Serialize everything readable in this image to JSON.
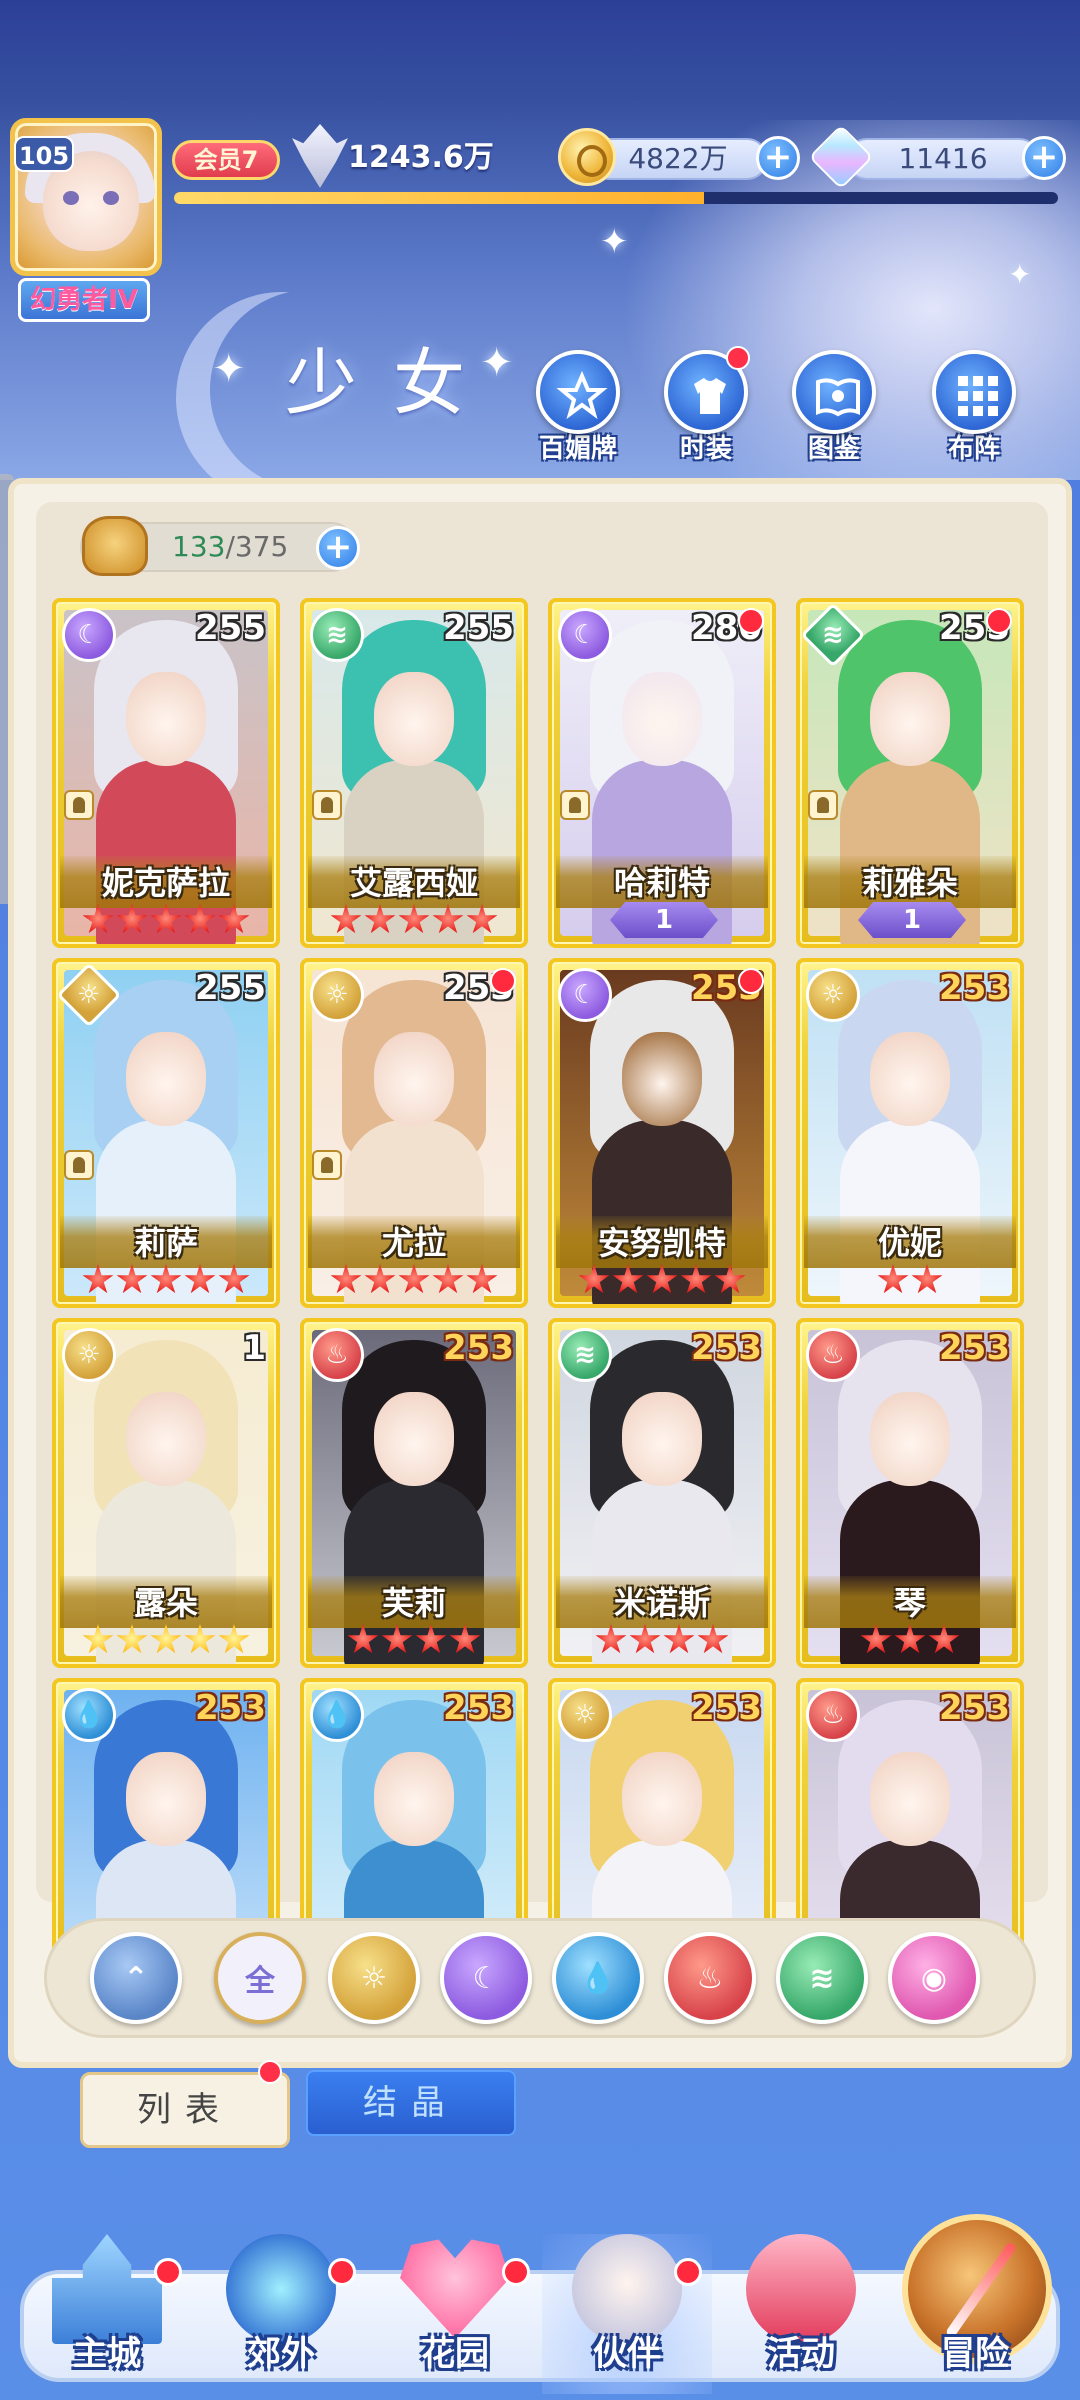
{
  "player": {
    "level": "105",
    "title": "幻勇者IV",
    "vip": "会员7",
    "power": "1243.6万",
    "gold": "4822万",
    "gems": "11416",
    "exp_progress": 0.6
  },
  "section_title": "少女",
  "top_menu": [
    {
      "label": "百媚牌",
      "icon": "star-badge-icon",
      "dot": false
    },
    {
      "label": "时装",
      "icon": "outfit-icon",
      "dot": true
    },
    {
      "label": "图鉴",
      "icon": "book-icon",
      "dot": false
    },
    {
      "label": "布阵",
      "icon": "grid-formation-icon",
      "dot": false
    }
  ],
  "collection": {
    "current": "133",
    "total": "/375"
  },
  "cards": [
    {
      "name": "妮克萨拉",
      "level": "255",
      "element": "moon",
      "stars": 5,
      "star_color": "red",
      "role": true,
      "dot": false,
      "gold_level": false
    },
    {
      "name": "艾露西娅",
      "level": "255",
      "element": "wind",
      "stars": 5,
      "star_color": "red",
      "role": true,
      "dot": false,
      "gold_level": false
    },
    {
      "name": "哈莉特",
      "level": "280",
      "element": "moon",
      "awaken": "1",
      "role": true,
      "dot": true,
      "gold_level": false
    },
    {
      "name": "莉雅朵",
      "level": "255",
      "element": "wind",
      "awaken": "1",
      "role": true,
      "dot": true,
      "gold_level": false,
      "diamond": true
    },
    {
      "name": "莉萨",
      "level": "255",
      "element": "sun",
      "stars": 5,
      "star_color": "red",
      "role": true,
      "dot": false,
      "gold_level": false,
      "diamond": true
    },
    {
      "name": "尤拉",
      "level": "253",
      "element": "sun",
      "stars": 5,
      "star_color": "red",
      "role": true,
      "dot": true,
      "gold_level": false
    },
    {
      "name": "安努凯特",
      "level": "253",
      "element": "moon",
      "stars": 5,
      "star_color": "red",
      "role": false,
      "dot": true,
      "gold_level": true
    },
    {
      "name": "优妮",
      "level": "253",
      "element": "sun",
      "stars": 2,
      "star_color": "red",
      "role": false,
      "dot": false,
      "gold_level": true
    },
    {
      "name": "露朵",
      "level": "1",
      "element": "sun",
      "stars": 5,
      "star_color": "gold",
      "role": false,
      "dot": false,
      "gold_level": false
    },
    {
      "name": "芙莉",
      "level": "253",
      "element": "fire",
      "stars": 4,
      "star_color": "red",
      "role": false,
      "dot": false,
      "gold_level": true
    },
    {
      "name": "米诺斯",
      "level": "253",
      "element": "wind",
      "stars": 4,
      "star_color": "red",
      "role": false,
      "dot": false,
      "gold_level": true
    },
    {
      "name": "琴",
      "level": "253",
      "element": "fire",
      "stars": 3,
      "star_color": "red",
      "role": false,
      "dot": false,
      "gold_level": true
    },
    {
      "name": "",
      "level": "253",
      "element": "water",
      "role": false,
      "dot": false,
      "gold_level": true
    },
    {
      "name": "",
      "level": "253",
      "element": "water",
      "role": false,
      "dot": false,
      "gold_level": true
    },
    {
      "name": "",
      "level": "253",
      "element": "sun",
      "role": false,
      "dot": false,
      "gold_level": true
    },
    {
      "name": "",
      "level": "253",
      "element": "fire",
      "role": false,
      "dot": false,
      "gold_level": true
    }
  ],
  "filters": [
    {
      "key": "sort",
      "label": ""
    },
    {
      "key": "all",
      "label": "全"
    },
    {
      "key": "sun",
      "label": ""
    },
    {
      "key": "moon",
      "label": ""
    },
    {
      "key": "water",
      "label": ""
    },
    {
      "key": "fire",
      "label": ""
    },
    {
      "key": "wind",
      "label": ""
    },
    {
      "key": "star",
      "label": ""
    }
  ],
  "tabs": {
    "list": "列表",
    "crystal": "结晶"
  },
  "bottom_nav": [
    {
      "label": "主城",
      "icon": "castle-icon",
      "dot": true
    },
    {
      "label": "郊外",
      "icon": "portal-icon",
      "dot": true
    },
    {
      "label": "花园",
      "icon": "heart-garden-icon",
      "dot": true
    },
    {
      "label": "伙伴",
      "icon": "partner-avatar-icon",
      "dot": true
    },
    {
      "label": "活动",
      "icon": "gift-box-icon",
      "dot": false
    },
    {
      "label": "冒险",
      "icon": "compass-icon",
      "dot": false
    }
  ],
  "colors": {
    "sun": "#d4a23a",
    "moon": "#8d5be0",
    "water": "#3aa0e0",
    "fire": "#d8434a",
    "wind": "#38a86a",
    "star": "#e058b0",
    "sort": "#5a86c8"
  }
}
